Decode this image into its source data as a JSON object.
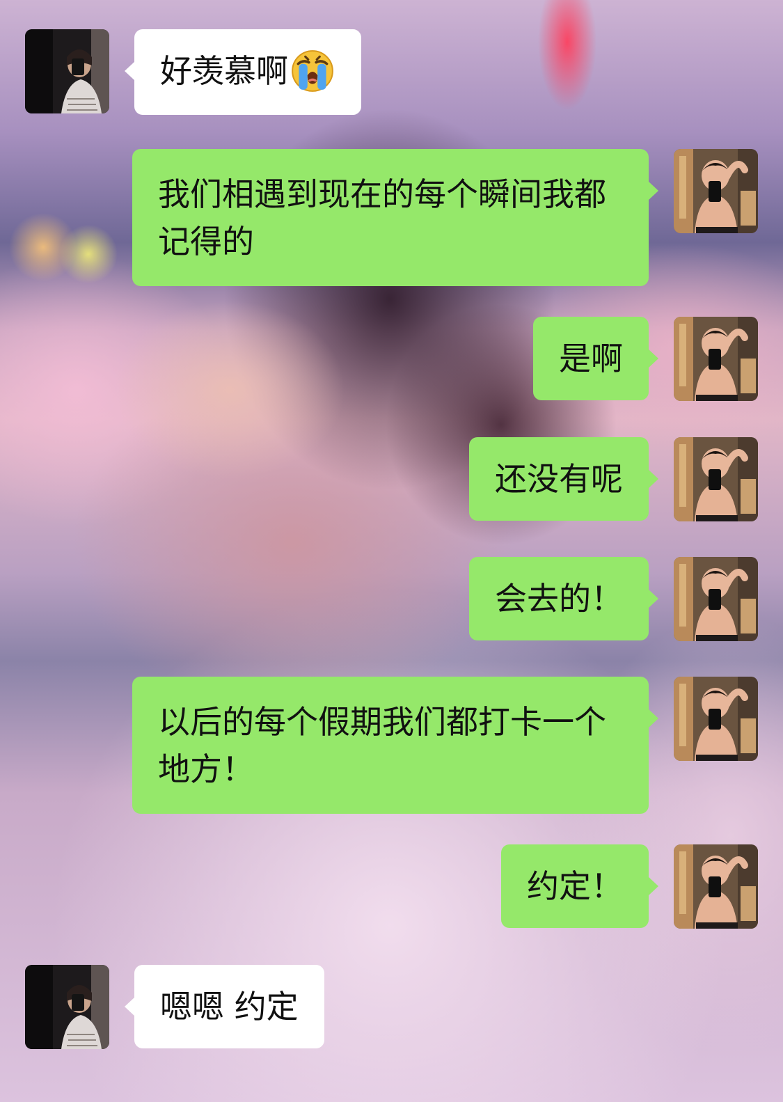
{
  "chat": {
    "messages": [
      {
        "side": "incoming",
        "text": "好羡慕啊",
        "emoji": "loudly-crying-face"
      },
      {
        "side": "outgoing",
        "text": "我们相遇到现在的每个瞬间我都记得的"
      },
      {
        "side": "outgoing",
        "text": "是啊"
      },
      {
        "side": "outgoing",
        "text": "还没有呢"
      },
      {
        "side": "outgoing",
        "text": "会去的！"
      },
      {
        "side": "outgoing",
        "text": "以后的每个假期我们都打卡一个地方！"
      },
      {
        "side": "outgoing",
        "text": "约定！"
      },
      {
        "side": "incoming",
        "text": "嗯嗯 约定"
      }
    ]
  },
  "colors": {
    "outgoing_bubble": "#95e86a",
    "incoming_bubble": "#ffffff",
    "text": "#111111"
  },
  "icons": {
    "incoming_avatar": "contact-avatar-photo",
    "outgoing_avatar": "self-avatar-photo"
  }
}
